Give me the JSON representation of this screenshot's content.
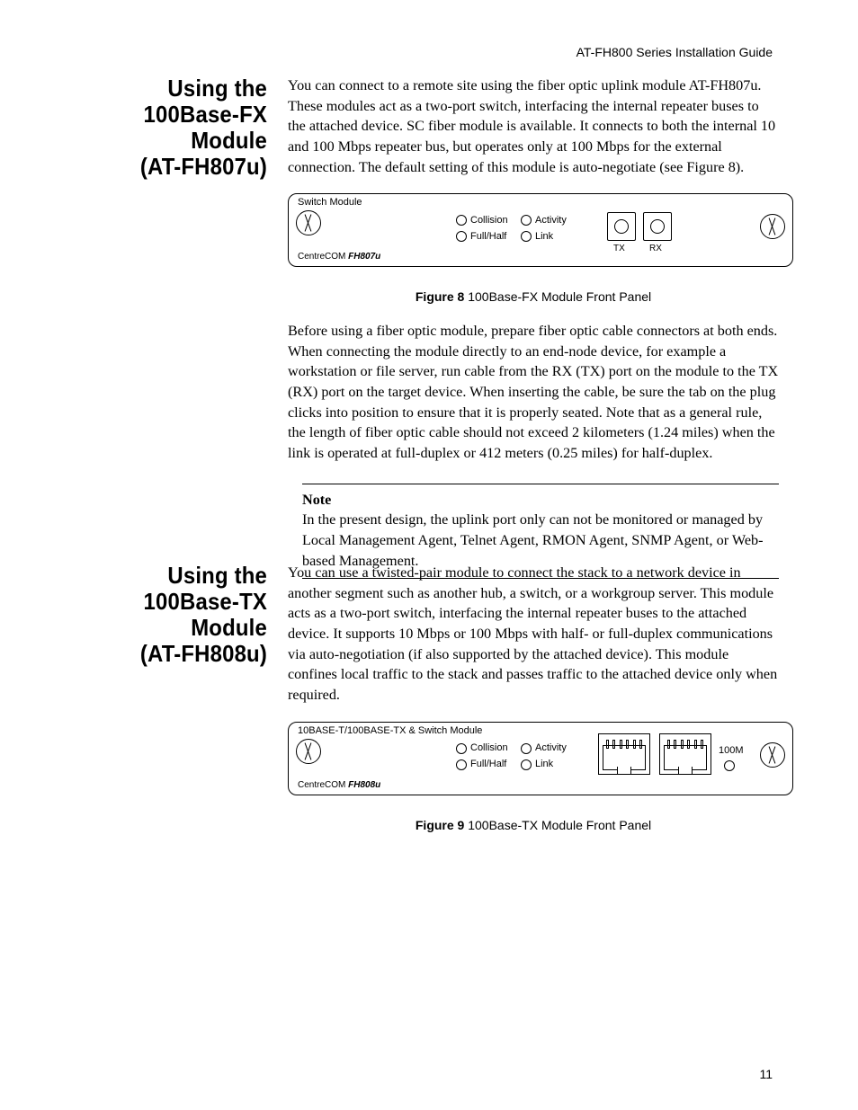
{
  "header": {
    "doc_title": "AT-FH800 Series Installation Guide"
  },
  "page_number": "11",
  "section1": {
    "title_l1": "Using the",
    "title_l2": "100Base-FX",
    "title_l3": "Module",
    "title_l4": "(AT-FH807u)",
    "p1": "You can connect to a remote site using the fiber optic uplink module AT-FH807u. These modules act as a two-port switch, interfacing the internal repeater buses to the attached device. SC fiber module is available. It connects to both the internal 10 and 100 Mbps repeater bus, but operates only at 100 Mbps for the external connection. The default setting of this module is auto-negotiate (see Figure 8).",
    "panel": {
      "title": "Switch Module",
      "brand_prefix": "CentreCOM ",
      "brand_model": "FH807u",
      "leds": {
        "collision": "Collision",
        "activity": "Activity",
        "fullhalf": "Full/Half",
        "link": "Link"
      },
      "ports": {
        "tx": "TX",
        "rx": "RX"
      }
    },
    "fig_caption_bold": "Figure 8",
    "fig_caption_rest": " 100Base-FX Module Front Panel",
    "p2": "Before using a fiber optic module, prepare fiber optic cable connectors at both ends. When connecting the module directly to an end-node device, for example a workstation or file server, run cable from the RX (TX) port on the module to the TX (RX) port on the target device. When inserting the cable, be sure the tab on the plug clicks into position to ensure that it is properly seated. Note that as a general rule, the length of fiber optic cable should not exceed 2 kilometers (1.24 miles) when the link is operated at full-duplex or 412 meters (0.25 miles) for half-duplex.",
    "note_title": "Note",
    "note_body": "In the present design, the uplink port only can not be monitored or managed by Local Management Agent, Telnet Agent, RMON Agent, SNMP Agent, or Web-based Management."
  },
  "section2": {
    "title_l1": "Using the",
    "title_l2": "100Base-TX",
    "title_l3": "Module",
    "title_l4": "(AT-FH808u)",
    "p1": "You can use a twisted-pair module to connect the stack to a network device in another segment such as another hub, a switch, or a workgroup server. This module acts as a two-port switch, interfacing the internal repeater buses to the attached device. It supports 10 Mbps or 100 Mbps with half- or full-duplex communications via auto-negotiation (if also supported by the attached device). This module confines local traffic to the stack and passes traffic to the attached device only when required.",
    "panel": {
      "title": "10BASE-T/100BASE-TX & Switch Module",
      "brand_prefix": "CentreCOM ",
      "brand_model": "FH808u",
      "leds": {
        "collision": "Collision",
        "activity": "Activity",
        "fullhalf": "Full/Half",
        "link": "Link"
      },
      "speed": "100M"
    },
    "fig_caption_bold": "Figure 9",
    "fig_caption_rest": " 100Base-TX Module Front Panel"
  }
}
